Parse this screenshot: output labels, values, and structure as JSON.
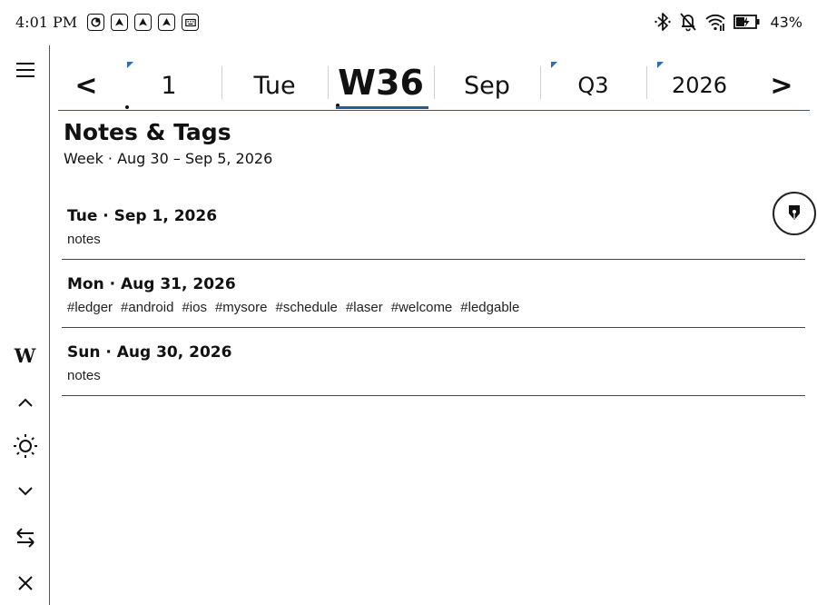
{
  "status_bar": {
    "time": "4:01 PM",
    "battery_percent": "43%",
    "left_icons": [
      "app-notification-icon",
      "upload-icon",
      "upload-icon",
      "upload-icon",
      "keyboard-icon"
    ],
    "right_icons": [
      "bluetooth-icon",
      "notifications-off-icon",
      "wifi-icon",
      "battery-charging-icon"
    ]
  },
  "sidebar": {
    "view_letter": "W",
    "buttons": [
      "menu-icon",
      "chevron-up-icon",
      "brightness-icon",
      "chevron-down-icon",
      "swap-icon",
      "close-icon"
    ]
  },
  "date_strip": {
    "prev": "<",
    "next": ">",
    "cells": [
      {
        "label": "1",
        "flag": true
      },
      {
        "label": "Tue",
        "flag": false
      },
      {
        "label": "W36",
        "flag": false,
        "active": true
      },
      {
        "label": "Sep",
        "flag": false
      },
      {
        "label": "Q3",
        "flag": true
      },
      {
        "label": "2026",
        "flag": true
      }
    ],
    "accent_color": "#2b5a91"
  },
  "page": {
    "title": "Notes & Tags",
    "subtitle": "Week · Aug 30 – Sep 5, 2026"
  },
  "entries": [
    {
      "title": "Tue · Sep 1, 2026",
      "subtitle": "notes"
    },
    {
      "title": "Mon · Aug 31, 2026",
      "tags": [
        "#ledger",
        "#android",
        "#ios",
        "#mysore",
        "#schedule",
        "#laser",
        "#welcome",
        "#ledgable"
      ]
    },
    {
      "title": "Sun · Aug 30, 2026",
      "subtitle": "notes"
    }
  ]
}
